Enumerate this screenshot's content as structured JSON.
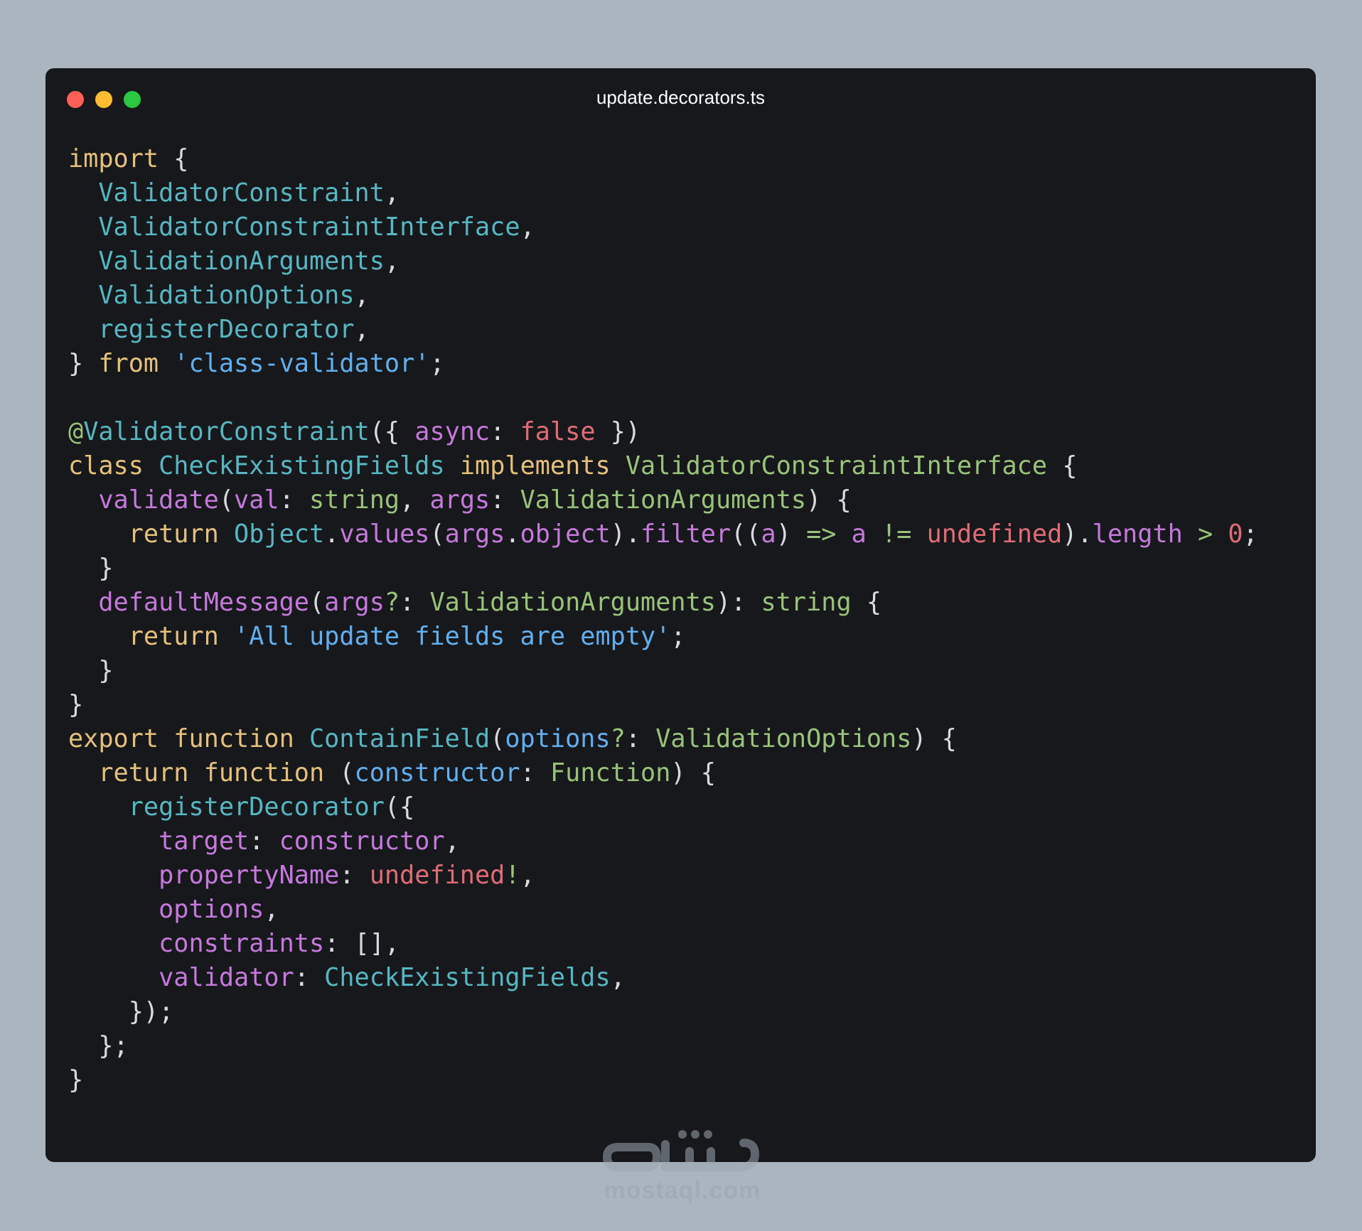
{
  "window": {
    "title": "update.decorators.ts",
    "controls": [
      "close",
      "minimize",
      "maximize"
    ]
  },
  "colors": {
    "background": "#abb5bf",
    "editor_bg": "#16181b",
    "keyword": "#e5c07b",
    "identifier": "#56b6c2",
    "string": "#61afef",
    "property": "#c678dd",
    "type": "#98c379",
    "literal": "#e06c75",
    "punctuation": "#d7dae0"
  },
  "code_lines": [
    [
      [
        "kw",
        "import"
      ],
      [
        "pun",
        " {"
      ]
    ],
    [
      [
        "pun",
        "  "
      ],
      [
        "fn",
        "ValidatorConstraint"
      ],
      [
        "pun",
        ","
      ]
    ],
    [
      [
        "pun",
        "  "
      ],
      [
        "fn",
        "ValidatorConstraintInterface"
      ],
      [
        "pun",
        ","
      ]
    ],
    [
      [
        "pun",
        "  "
      ],
      [
        "fn",
        "ValidationArguments"
      ],
      [
        "pun",
        ","
      ]
    ],
    [
      [
        "pun",
        "  "
      ],
      [
        "fn",
        "ValidationOptions"
      ],
      [
        "pun",
        ","
      ]
    ],
    [
      [
        "pun",
        "  "
      ],
      [
        "fn",
        "registerDecorator"
      ],
      [
        "pun",
        ","
      ]
    ],
    [
      [
        "pun",
        "} "
      ],
      [
        "kw",
        "from"
      ],
      [
        "pun",
        " "
      ],
      [
        "str",
        "'class-validator'"
      ],
      [
        "pun",
        ";"
      ]
    ],
    [],
    [
      [
        "type",
        "@"
      ],
      [
        "fn",
        "ValidatorConstraint"
      ],
      [
        "pun",
        "({ "
      ],
      [
        "prop",
        "async"
      ],
      [
        "pun",
        ": "
      ],
      [
        "lit",
        "false"
      ],
      [
        "pun",
        " })"
      ]
    ],
    [
      [
        "kw",
        "class"
      ],
      [
        "pun",
        " "
      ],
      [
        "fn",
        "CheckExistingFields"
      ],
      [
        "pun",
        " "
      ],
      [
        "kw",
        "implements"
      ],
      [
        "pun",
        " "
      ],
      [
        "type",
        "ValidatorConstraintInterface"
      ],
      [
        "pun",
        " {"
      ]
    ],
    [
      [
        "pun",
        "  "
      ],
      [
        "prop",
        "validate"
      ],
      [
        "pun",
        "("
      ],
      [
        "prop",
        "val"
      ],
      [
        "pun",
        ": "
      ],
      [
        "type",
        "string"
      ],
      [
        "pun",
        ", "
      ],
      [
        "prop",
        "args"
      ],
      [
        "pun",
        ": "
      ],
      [
        "type",
        "ValidationArguments"
      ],
      [
        "pun",
        ") {"
      ]
    ],
    [
      [
        "pun",
        "    "
      ],
      [
        "kw",
        "return"
      ],
      [
        "pun",
        " "
      ],
      [
        "fn",
        "Object"
      ],
      [
        "pun",
        "."
      ],
      [
        "prop",
        "values"
      ],
      [
        "pun",
        "("
      ],
      [
        "prop",
        "args"
      ],
      [
        "pun",
        "."
      ],
      [
        "prop",
        "object"
      ],
      [
        "pun",
        ")."
      ],
      [
        "prop",
        "filter"
      ],
      [
        "pun",
        "(("
      ],
      [
        "prop",
        "a"
      ],
      [
        "pun",
        ") "
      ],
      [
        "type",
        "=>"
      ],
      [
        "pun",
        " "
      ],
      [
        "prop",
        "a"
      ],
      [
        "pun",
        " "
      ],
      [
        "type",
        "!="
      ],
      [
        "pun",
        " "
      ],
      [
        "lit",
        "undefined"
      ],
      [
        "pun",
        ")."
      ],
      [
        "prop",
        "length"
      ],
      [
        "pun",
        " "
      ],
      [
        "type",
        ">"
      ],
      [
        "pun",
        " "
      ],
      [
        "lit",
        "0"
      ],
      [
        "pun",
        ";"
      ]
    ],
    [
      [
        "pun",
        "  }"
      ]
    ],
    [
      [
        "pun",
        "  "
      ],
      [
        "prop",
        "defaultMessage"
      ],
      [
        "pun",
        "("
      ],
      [
        "prop",
        "args"
      ],
      [
        "type",
        "?"
      ],
      [
        "pun",
        ": "
      ],
      [
        "type",
        "ValidationArguments"
      ],
      [
        "pun",
        "): "
      ],
      [
        "type",
        "string"
      ],
      [
        "pun",
        " {"
      ]
    ],
    [
      [
        "pun",
        "    "
      ],
      [
        "kw",
        "return"
      ],
      [
        "pun",
        " "
      ],
      [
        "str",
        "'All update fields are empty'"
      ],
      [
        "pun",
        ";"
      ]
    ],
    [
      [
        "pun",
        "  }"
      ]
    ],
    [
      [
        "pun",
        "}"
      ]
    ],
    [
      [
        "kw",
        "export"
      ],
      [
        "pun",
        " "
      ],
      [
        "kw",
        "function"
      ],
      [
        "pun",
        " "
      ],
      [
        "fn",
        "ContainField"
      ],
      [
        "pun",
        "("
      ],
      [
        "str",
        "options"
      ],
      [
        "type",
        "?"
      ],
      [
        "pun",
        ": "
      ],
      [
        "type",
        "ValidationOptions"
      ],
      [
        "pun",
        ") {"
      ]
    ],
    [
      [
        "pun",
        "  "
      ],
      [
        "kw",
        "return"
      ],
      [
        "pun",
        " "
      ],
      [
        "kw",
        "function"
      ],
      [
        "pun",
        " ("
      ],
      [
        "str",
        "constructor"
      ],
      [
        "pun",
        ": "
      ],
      [
        "type",
        "Function"
      ],
      [
        "pun",
        ") {"
      ]
    ],
    [
      [
        "pun",
        "    "
      ],
      [
        "fn",
        "registerDecorator"
      ],
      [
        "pun",
        "({"
      ]
    ],
    [
      [
        "pun",
        "      "
      ],
      [
        "prop",
        "target"
      ],
      [
        "pun",
        ": "
      ],
      [
        "prop",
        "constructor"
      ],
      [
        "pun",
        ","
      ]
    ],
    [
      [
        "pun",
        "      "
      ],
      [
        "prop",
        "propertyName"
      ],
      [
        "pun",
        ": "
      ],
      [
        "lit",
        "undefined"
      ],
      [
        "type",
        "!"
      ],
      [
        "pun",
        ","
      ]
    ],
    [
      [
        "pun",
        "      "
      ],
      [
        "prop",
        "options"
      ],
      [
        "pun",
        ","
      ]
    ],
    [
      [
        "pun",
        "      "
      ],
      [
        "prop",
        "constraints"
      ],
      [
        "pun",
        ": [],"
      ]
    ],
    [
      [
        "pun",
        "      "
      ],
      [
        "prop",
        "validator"
      ],
      [
        "pun",
        ": "
      ],
      [
        "fn",
        "CheckExistingFields"
      ],
      [
        "pun",
        ","
      ]
    ],
    [
      [
        "pun",
        "    });"
      ]
    ],
    [
      [
        "pun",
        "  };"
      ]
    ],
    [
      [
        "pun",
        "}"
      ]
    ]
  ],
  "watermark": {
    "arabic": "مستقل",
    "latin": "mostaql.com"
  }
}
